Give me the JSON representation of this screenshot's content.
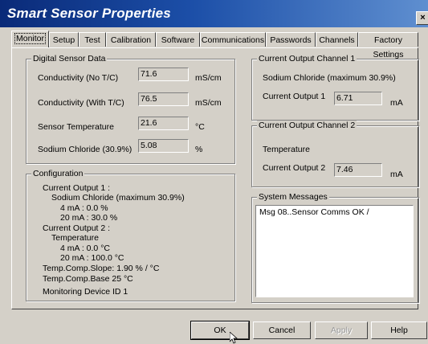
{
  "window": {
    "title": "Smart Sensor Properties",
    "close_glyph": "×"
  },
  "tabs": [
    {
      "label": "Monitor",
      "active": true
    },
    {
      "label": "Setup"
    },
    {
      "label": "Test"
    },
    {
      "label": "Calibration"
    },
    {
      "label": "Software"
    },
    {
      "label": "Communications"
    },
    {
      "label": "Passwords"
    },
    {
      "label": "Channels"
    },
    {
      "label": "Factory Settings"
    }
  ],
  "digital_sensor_data": {
    "title": "Digital Sensor Data",
    "rows": [
      {
        "label": "Conductivity   (No T/C)",
        "value": "71.6",
        "unit": "mS/cm"
      },
      {
        "label": "Conductivity (With T/C)",
        "value": "76.5",
        "unit": "mS/cm"
      },
      {
        "label": "Sensor Temperature",
        "value": "21.6",
        "unit": "°C"
      },
      {
        "label": "Sodium Chloride (30.9%)",
        "value": "5.08",
        "unit": "%"
      }
    ]
  },
  "current_output_1": {
    "title": "Current Output Channel 1",
    "description": "Sodium Chloride (maximum 30.9%)",
    "label": "Current Output 1",
    "value": "6.71",
    "unit": "mA"
  },
  "current_output_2": {
    "title": "Current Output Channel 2",
    "description": "Temperature",
    "label": "Current Output 2",
    "value": "7.46",
    "unit": "mA"
  },
  "configuration": {
    "title": "Configuration",
    "lines": [
      "Current Output 1 :",
      "Sodium Chloride (maximum 30.9%)",
      "4 mA : 0.0 %",
      "20 mA : 30.0 %",
      "Current Output 2 :",
      "Temperature",
      "4 mA : 0.0 °C",
      "20 mA : 100.0 °C",
      "Temp.Comp.Slope:  1.90 % / °C",
      "Temp.Comp.Base 25 °C",
      "Monitoring Device ID 1"
    ]
  },
  "system_messages": {
    "title": "System Messages",
    "message": "Msg 08..Sensor Comms OK   /"
  },
  "buttons": {
    "ok": "OK",
    "cancel": "Cancel",
    "apply": "Apply",
    "help": "Help"
  }
}
